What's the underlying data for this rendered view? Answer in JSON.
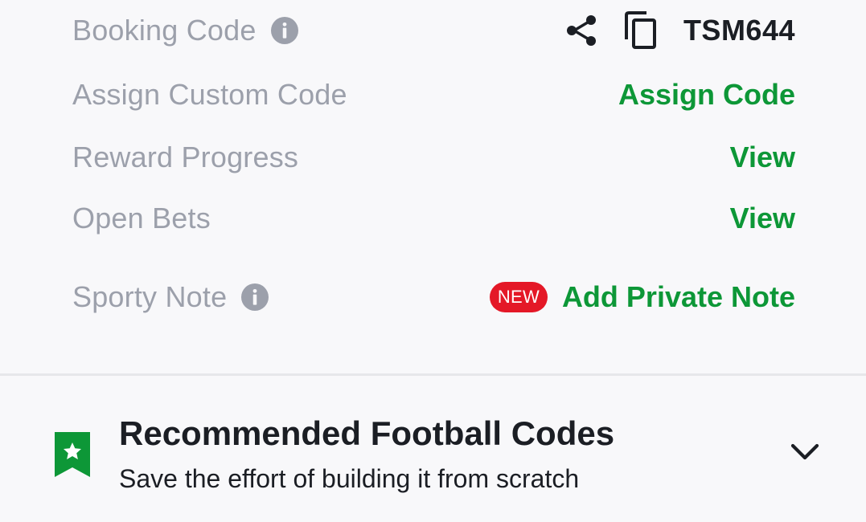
{
  "rows": {
    "booking_code": {
      "label": "Booking Code",
      "info_icon": "info-icon",
      "share_icon": "share-icon",
      "copy_icon": "copy-icon",
      "value": "TSM644"
    },
    "assign_custom_code": {
      "label": "Assign Custom Code",
      "action": "Assign Code"
    },
    "reward_progress": {
      "label": "Reward Progress",
      "action": "View"
    },
    "open_bets": {
      "label": "Open Bets",
      "action": "View"
    },
    "sporty_note": {
      "label": "Sporty Note",
      "info_icon": "info-icon",
      "badge": "NEW",
      "action": "Add Private Note"
    }
  },
  "recommended": {
    "icon": "bookmark-star-icon",
    "title": "Recommended Football Codes",
    "subtitle": "Save the effort of building it from scratch",
    "toggle_icon": "chevron-down-icon"
  },
  "colors": {
    "background": "#f8f8fa",
    "label_gray": "#9ca0ab",
    "accent_green": "#0d9737",
    "badge_red": "#e41827",
    "text_dark": "#1b1e24"
  }
}
